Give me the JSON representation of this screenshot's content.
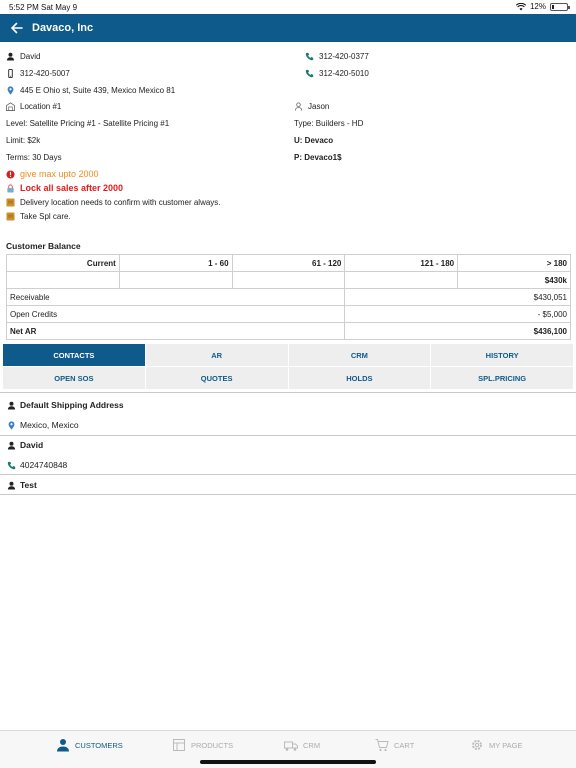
{
  "status_bar": {
    "time": "5:52 PM",
    "date": "Sat May 9",
    "battery": "12%",
    "battery_level": 0.12
  },
  "header": {
    "title": "Davaco, Inc"
  },
  "customer": {
    "contact_name": "David",
    "phone_mobile": "312-420-5007",
    "address": "445 E Ohio st, Suite 439, Mexico Mexico 81",
    "phone_1": "312-420-0377",
    "phone_2": "312-420-5010",
    "location": "Location #1",
    "rep": "Jason",
    "level": "Level: Satellite Pricing #1 - Satellite Pricing #1",
    "type": "Type: Builders - HD",
    "limit": "Limit: $2k",
    "username": "U: Devaco",
    "terms": "Terms: 30 Days",
    "password": "P: Devaco1$"
  },
  "notes": [
    {
      "text": "give max upto 2000",
      "icon": "alert-icon",
      "color": "#f28b1a"
    },
    {
      "text": "Lock all sales after 2000",
      "icon": "lock-icon",
      "color": "#e01b1b"
    },
    {
      "text": "Delivery location needs to confirm with customer always.",
      "icon": "note-icon"
    },
    {
      "text": "Take Spl care.",
      "icon": "note-icon"
    }
  ],
  "balance": {
    "title": "Customer Balance",
    "headers": [
      "Current",
      "1 - 60",
      "61 - 120",
      "121 - 180",
      "> 180"
    ],
    "aging_values": [
      "",
      "",
      "",
      "",
      "$430k"
    ],
    "receivable_label": "Receivable",
    "receivable": "$430,051",
    "open_credits_label": "Open Credits",
    "open_credits": "- $5,000",
    "net_ar_label": "Net AR",
    "net_ar": "$436,100"
  },
  "tabs": [
    "CONTACTS",
    "AR",
    "CRM",
    "HISTORY",
    "OPEN SOS",
    "QUOTES",
    "HOLDS",
    "SPL.PRICING"
  ],
  "contacts": {
    "shipping_title": "Default Shipping Address",
    "shipping_location": "Mexico, Mexico",
    "contact_1": "David",
    "contact_1_phone": "4024740848",
    "contact_2": "Test"
  },
  "bottom_nav": [
    "CUSTOMERS",
    "PRODUCTS",
    "CRM",
    "CART",
    "MY PAGE"
  ],
  "colors": {
    "primary": "#0e5a8a",
    "tab_inactive": "#eeeeee"
  }
}
